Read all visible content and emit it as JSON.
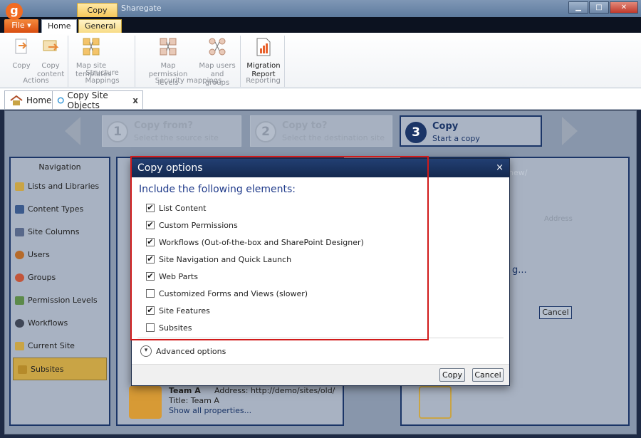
{
  "window": {
    "app_logo": "g",
    "contextual_tab": "Copy",
    "app_title": "Sharegate"
  },
  "ribbon_tabs": {
    "file": "File ▾",
    "home": "Home",
    "general": "General"
  },
  "ribbon": {
    "actions": {
      "label": "Actions",
      "copy": "Copy",
      "copy_content": [
        "Copy",
        "content"
      ]
    },
    "structure": {
      "label": "Structure Mappings",
      "map_site_templates": [
        "Map site",
        "templates"
      ]
    },
    "security": {
      "label": "Security mappings",
      "map_permission_levels": [
        "Map",
        "permission levels"
      ],
      "map_users_groups": [
        "Map users",
        "and groups"
      ]
    },
    "reporting": {
      "label": "Reporting",
      "migration_report": [
        "Migration",
        "Report"
      ]
    }
  },
  "doc_tabs": {
    "home": "Home",
    "copy_site_objects": "Copy Site Objects",
    "close": "x"
  },
  "wizard": {
    "steps": [
      {
        "num": "1",
        "title": "Copy from?",
        "subtitle": "Select the source site"
      },
      {
        "num": "2",
        "title": "Copy to?",
        "subtitle": "Select the destination site"
      },
      {
        "num": "3",
        "title": "Copy",
        "subtitle": "Start a copy"
      }
    ]
  },
  "navigation": {
    "title": "Navigation",
    "items": [
      {
        "label": "Lists and Libraries",
        "icon": "list-icon"
      },
      {
        "label": "Content Types",
        "icon": "content-type-icon"
      },
      {
        "label": "Site Columns",
        "icon": "column-icon"
      },
      {
        "label": "Users",
        "icon": "user-icon"
      },
      {
        "label": "Groups",
        "icon": "group-icon"
      },
      {
        "label": "Permission Levels",
        "icon": "permission-icon"
      },
      {
        "label": "Workflows",
        "icon": "workflow-icon"
      },
      {
        "label": "Current Site",
        "icon": "site-icon"
      },
      {
        "label": "Subsites",
        "icon": "subsite-icon"
      }
    ],
    "selected": "Subsites"
  },
  "background": {
    "dest_url_fragment": "new/",
    "address_column": "Address",
    "progress_fragment": "g...",
    "cancel": "Cancel",
    "team": {
      "name": "Team A",
      "address": "Address: http://demo/sites/old/team",
      "title": "Title: Team A",
      "show_all": "Show all properties..."
    }
  },
  "dialog": {
    "title": "Copy options",
    "close": "×",
    "heading": "Include the following elements:",
    "options": [
      {
        "label": "List Content",
        "checked": true
      },
      {
        "label": "Custom Permissions",
        "checked": true
      },
      {
        "label": "Workflows (Out-of-the-box and SharePoint Designer)",
        "checked": true
      },
      {
        "label": "Site Navigation and Quick Launch",
        "checked": true
      },
      {
        "label": "Web Parts",
        "checked": true
      },
      {
        "label": "Customized Forms and Views (slower)",
        "checked": false
      },
      {
        "label": "Site Features",
        "checked": true
      },
      {
        "label": "Subsites",
        "checked": false
      }
    ],
    "advanced_options": "Advanced options",
    "copy_button": "Copy",
    "cancel_button": "Cancel"
  }
}
